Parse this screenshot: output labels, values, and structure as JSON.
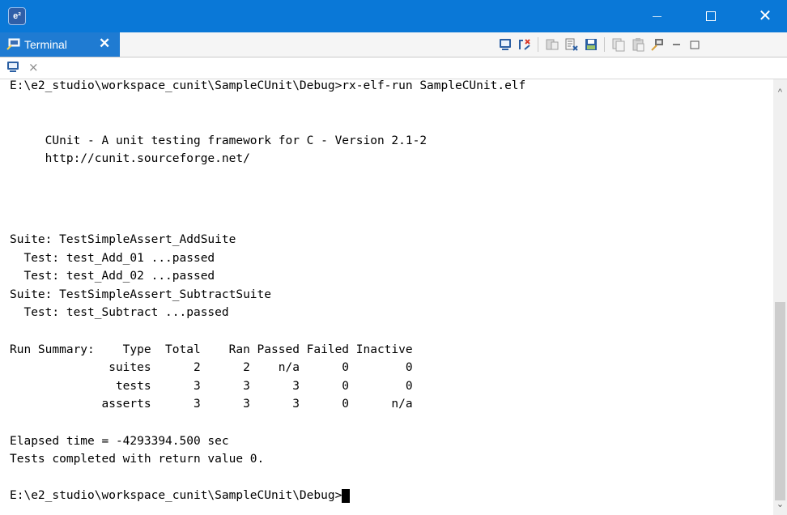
{
  "window": {
    "app_icon_text": "e²",
    "controls": {
      "close_glyph": "✕"
    },
    "accent_color": "#0a78d7"
  },
  "view_tab": {
    "label": "Terminal",
    "icon": "terminal-connect-icon",
    "close_glyph": "✕"
  },
  "toolbar": {
    "icons": [
      "terminal-icon",
      "connect-icon",
      "disconnect-icon",
      "clear-console-icon",
      "save-icon",
      "copy-icon",
      "paste-icon",
      "settings-icon",
      "view-menu-icon",
      "minimize-view-icon"
    ]
  },
  "terminal_tab": {
    "icon": "terminal-icon",
    "close_glyph": "⨯"
  },
  "terminal": {
    "lines": [
      "E:\\e2_studio\\workspace_cunit\\SampleCUnit\\Debug>rx-elf-run SampleCUnit.elf",
      "",
      "",
      "     CUnit - A unit testing framework for C - Version 2.1-2",
      "     http://cunit.sourceforge.net/",
      "",
      "",
      "Suite: TestSimpleAssert_AddSuite",
      "  Test: test_Add_01 ...passed",
      "  Test: test_Add_02 ...passed",
      "Suite: TestSimpleAssert_SubtractSuite",
      "  Test: test_Subtract ...passed",
      "",
      "Run Summary:    Type  Total    Ran Passed Failed Inactive",
      "              suites      2      2    n/a      0        0",
      "               tests      3      3      3      0        0",
      "             asserts      3      3      3      0      n/a",
      "",
      "Elapsed time = -4293394.500 sec",
      "Tests completed with return value 0.",
      ""
    ],
    "prompt": "E:\\e2_studio\\workspace_cunit\\SampleCUnit\\Debug>"
  },
  "scrollbar": {
    "up_glyph": "^",
    "down_glyph": "⌄",
    "position_fraction": 1.0
  }
}
